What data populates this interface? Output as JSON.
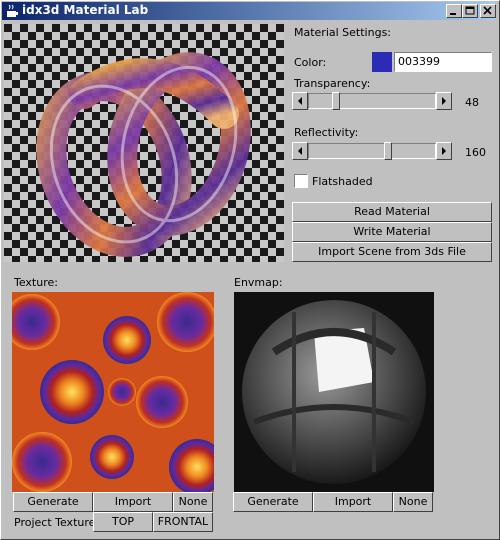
{
  "window": {
    "title": "idx3d Material Lab"
  },
  "settings": {
    "heading": "Material Settings:",
    "color_label": "Color:",
    "color_value": "003399",
    "color_swatch": "#2b2bb4",
    "transparency_label": "Transparency:",
    "transparency_value": "48",
    "reflectivity_label": "Reflectivity:",
    "reflectivity_value": "160",
    "flatshaded_label": "Flatshaded",
    "flatshaded_checked": false
  },
  "buttons": {
    "read": "Read Material",
    "write": "Write Material",
    "import_scene": "Import Scene from 3ds File"
  },
  "texture": {
    "label": "Texture:",
    "generate": "Generate",
    "import": "Import",
    "none": "None",
    "project_label": "Project Texture:",
    "top": "TOP",
    "frontal": "FRONTAL"
  },
  "envmap": {
    "label": "Envmap:",
    "generate": "Generate",
    "import": "Import",
    "none": "None"
  }
}
